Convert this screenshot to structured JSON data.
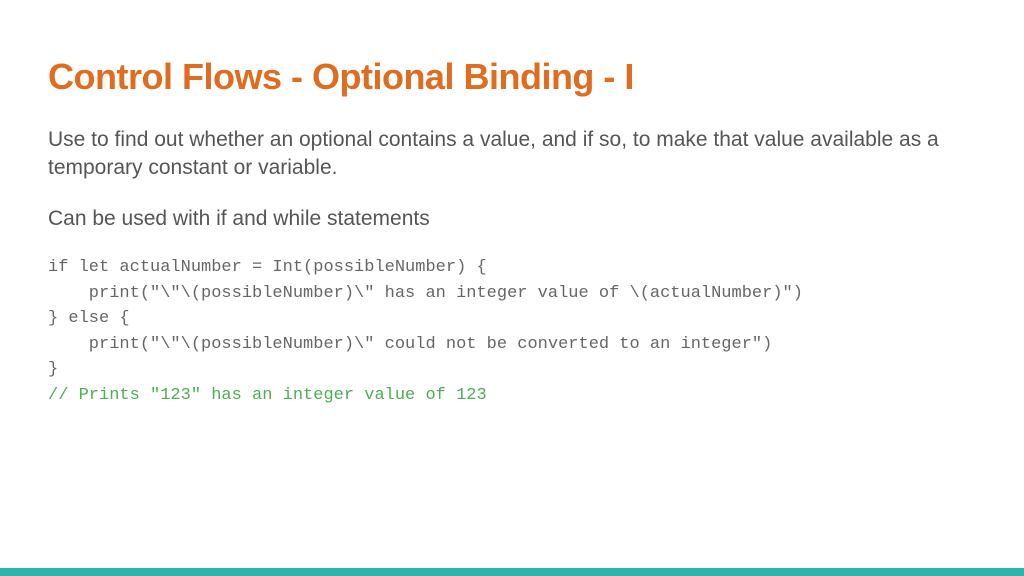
{
  "title": "Control Flows - Optional Binding - I",
  "paragraph1": "Use to find out whether an optional contains a value, and if so, to make that value available as a temporary constant or variable.",
  "paragraph2": "Can be used with if and while statements",
  "code": {
    "line1": "if let actualNumber = Int(possibleNumber) {",
    "line2": "    print(\"\\\"\\(possibleNumber)\\\" has an integer value of \\(actualNumber)\")",
    "line3": "} else {",
    "line4": "    print(\"\\\"\\(possibleNumber)\\\" could not be converted to an integer\")",
    "line5": "}",
    "comment": "// Prints \"123\" has an integer value of 123"
  }
}
